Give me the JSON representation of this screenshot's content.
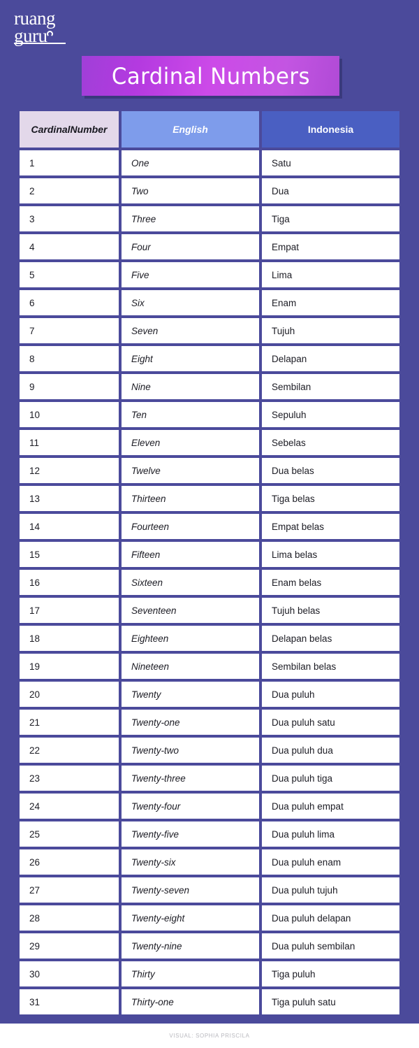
{
  "brand": {
    "logo_line1": "ruang",
    "logo_line2": "guru"
  },
  "title": "Cardinal Numbers",
  "colors": {
    "background": "#4b4a9b",
    "title_gradient_start": "#a03fd8",
    "title_gradient_end": "#cc4ae8",
    "header_number_bg": "#e3d8ea",
    "header_english_bg": "#7e9ceb",
    "header_indonesia_bg": "#4a5fc2",
    "cell_bg": "#ffffff",
    "grid_line": "#4b4a9b",
    "footer_text": "#b9b9bf"
  },
  "table": {
    "columns": [
      "Cardinal\nNumber",
      "English",
      "Indonesia"
    ],
    "headers": {
      "number_line1": "Cardinal",
      "number_line2": "Number",
      "english": "English",
      "indonesia": "Indonesia"
    },
    "rows": [
      {
        "number": "1",
        "english": "One",
        "indonesia": "Satu"
      },
      {
        "number": "2",
        "english": "Two",
        "indonesia": "Dua"
      },
      {
        "number": "3",
        "english": "Three",
        "indonesia": "Tiga"
      },
      {
        "number": "4",
        "english": "Four",
        "indonesia": "Empat"
      },
      {
        "number": "5",
        "english": "Five",
        "indonesia": "Lima"
      },
      {
        "number": "6",
        "english": "Six",
        "indonesia": "Enam"
      },
      {
        "number": "7",
        "english": "Seven",
        "indonesia": "Tujuh"
      },
      {
        "number": "8",
        "english": "Eight",
        "indonesia": "Delapan"
      },
      {
        "number": "9",
        "english": "Nine",
        "indonesia": "Sembilan"
      },
      {
        "number": "10",
        "english": "Ten",
        "indonesia": "Sepuluh"
      },
      {
        "number": "11",
        "english": "Eleven",
        "indonesia": "Sebelas"
      },
      {
        "number": "12",
        "english": "Twelve",
        "indonesia": "Dua belas"
      },
      {
        "number": "13",
        "english": "Thirteen",
        "indonesia": "Tiga belas"
      },
      {
        "number": "14",
        "english": "Fourteen",
        "indonesia": "Empat belas"
      },
      {
        "number": "15",
        "english": "Fifteen",
        "indonesia": "Lima belas"
      },
      {
        "number": "16",
        "english": "Sixteen",
        "indonesia": "Enam belas"
      },
      {
        "number": "17",
        "english": "Seventeen",
        "indonesia": "Tujuh belas"
      },
      {
        "number": "18",
        "english": "Eighteen",
        "indonesia": "Delapan belas"
      },
      {
        "number": "19",
        "english": "Nineteen",
        "indonesia": "Sembilan belas"
      },
      {
        "number": "20",
        "english": "Twenty",
        "indonesia": "Dua puluh"
      },
      {
        "number": "21",
        "english": "Twenty-one",
        "indonesia": "Dua puluh satu"
      },
      {
        "number": "22",
        "english": "Twenty-two",
        "indonesia": "Dua puluh dua"
      },
      {
        "number": "23",
        "english": "Twenty-three",
        "indonesia": "Dua puluh tiga"
      },
      {
        "number": "24",
        "english": "Twenty-four",
        "indonesia": "Dua puluh empat"
      },
      {
        "number": "25",
        "english": "Twenty-five",
        "indonesia": "Dua puluh lima"
      },
      {
        "number": "26",
        "english": "Twenty-six",
        "indonesia": "Dua puluh enam"
      },
      {
        "number": "27",
        "english": "Twenty-seven",
        "indonesia": "Dua puluh tujuh"
      },
      {
        "number": "28",
        "english": "Twenty-eight",
        "indonesia": "Dua puluh delapan"
      },
      {
        "number": "29",
        "english": "Twenty-nine",
        "indonesia": "Dua puluh sembilan"
      },
      {
        "number": "30",
        "english": "Thirty",
        "indonesia": "Tiga puluh"
      },
      {
        "number": "31",
        "english": "Thirty-one",
        "indonesia": "Tiga puluh satu"
      }
    ]
  },
  "footer": {
    "credit": "VISUAL: SOPHIA PRISCILA"
  }
}
